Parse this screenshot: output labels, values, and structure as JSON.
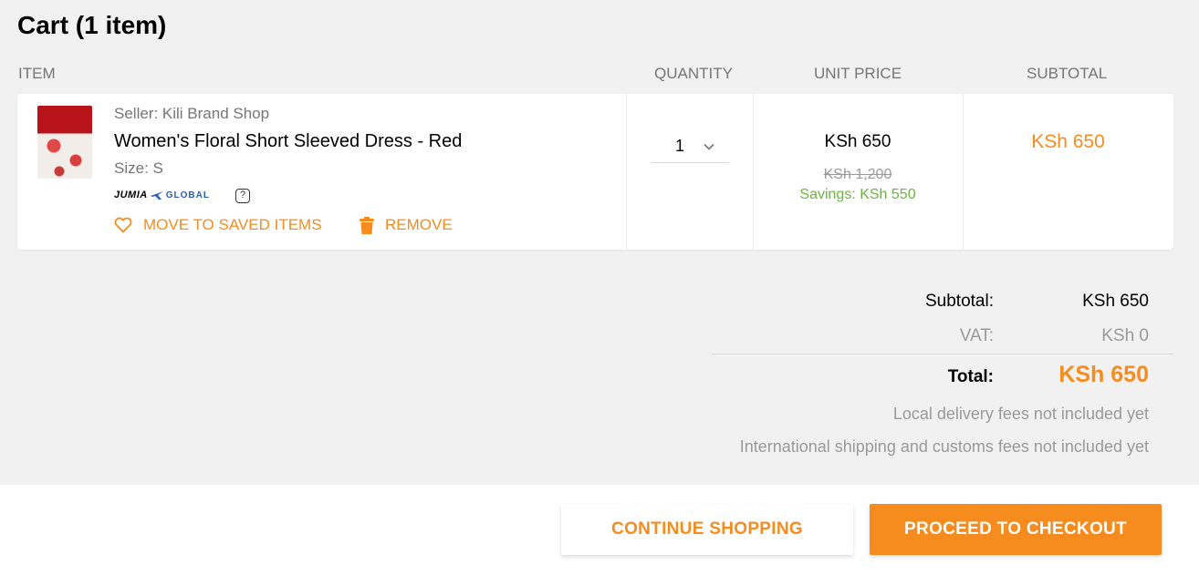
{
  "cart": {
    "title": "Cart (1 item)"
  },
  "columns": {
    "item": "ITEM",
    "quantity": "QUANTITY",
    "unit_price": "UNIT PRICE",
    "subtotal": "SUBTOTAL"
  },
  "item": {
    "seller": "Seller: Kili Brand Shop",
    "name": "Women's Floral Short Sleeved Dress - Red",
    "size": "Size: S",
    "badge_brand": "JUMIA",
    "badge_global": "GLOBAL",
    "help_icon_text": "?",
    "move_to_saved_label": "MOVE TO SAVED ITEMS",
    "remove_label": "REMOVE",
    "quantity": "1",
    "unit_price": "KSh 650",
    "old_price": "KSh 1,200",
    "savings": "Savings: KSh 550",
    "line_subtotal": "KSh 650",
    "icons": [
      "heart-icon",
      "trash-icon",
      "chevron-down-icon",
      "plane-icon"
    ]
  },
  "summary": {
    "subtotal_label": "Subtotal:",
    "subtotal_value": "KSh 650",
    "vat_label": "VAT:",
    "vat_value": "KSh 0",
    "total_label": "Total:",
    "total_value": "KSh 650",
    "note_local": "Local delivery fees not included yet",
    "note_international": "International shipping and customs fees not included yet"
  },
  "buttons": {
    "continue_label": "CONTINUE SHOPPING",
    "checkout_label": "PROCEED TO CHECKOUT"
  },
  "colors": {
    "accent": "#f68b1e",
    "savings": "#6bb440",
    "background": "#f1f1f2"
  }
}
